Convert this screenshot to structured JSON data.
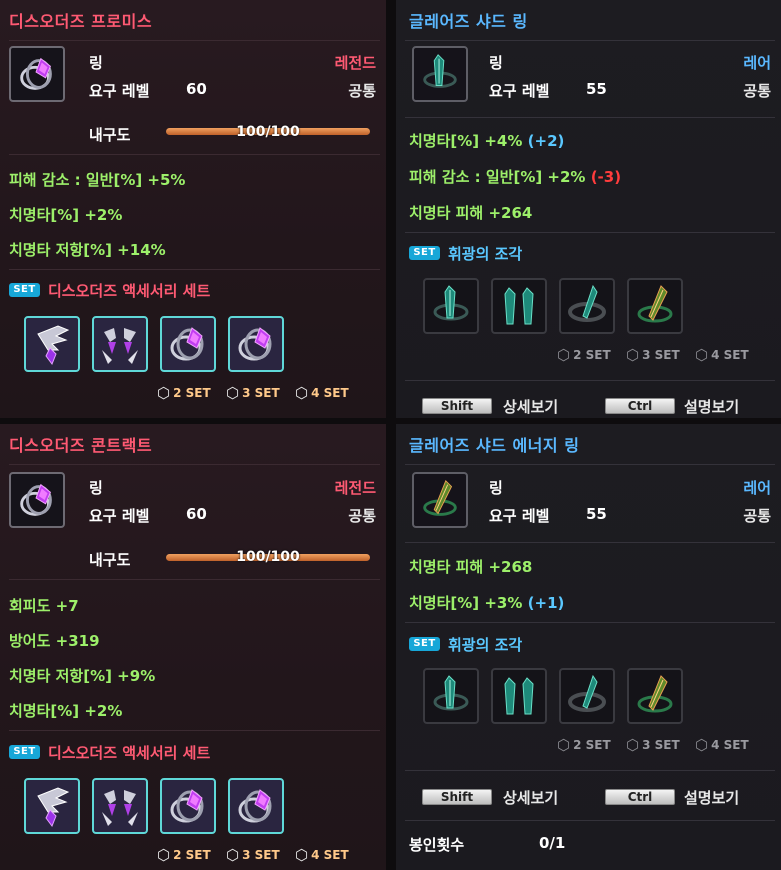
{
  "colors": {
    "legend": "#ff5a73",
    "rare": "#5ab8ff",
    "stat": "#9df06a",
    "bonus_up": "#5ac8ff",
    "bonus_down": "#ff3c3c",
    "set_badge": "#17a7d8",
    "durability_bar": "#e08a48"
  },
  "set_badge_text": "SET",
  "cube_glyph": "⬡",
  "panels": [
    {
      "title": "디스오더즈 프로미스",
      "item_type": "링",
      "grade": "레전드",
      "req_label": "요구 레벨",
      "req_level": "60",
      "class": "공통",
      "durability_label": "내구도",
      "durability_text": "100/100",
      "durability_fraction": 1.0,
      "stats": [
        "피해 감소 : 일반[%] +5%",
        "치명타[%] +2%",
        "치명타 저항[%] +14%"
      ],
      "set_name": "디스오더즈 액세서리 세트",
      "set_items": [
        "wing-purple-icon",
        "twin-pendant-icon",
        "purple-ring-icon",
        "purple-ring-icon"
      ],
      "set_counts": [
        "2 SET",
        "3 SET",
        "4 SET"
      ]
    },
    {
      "title": "글레어즈 샤드 링",
      "item_type": "링",
      "grade": "레어",
      "req_label": "요구 레벨",
      "req_level": "55",
      "class": "공통",
      "stats": [
        {
          "text": "치명타[%] +4%",
          "bonus": "(+2)"
        },
        {
          "text": "피해 감소 : 일반[%] +2%",
          "bonus": "(-3)"
        },
        {
          "text": "치명타 피해 +264",
          "bonus": ""
        }
      ],
      "set_name": "휘광의 조각",
      "set_items": [
        "teal-ring-icon",
        "teal-twin-icon",
        "teal-shard-ring-icon",
        "green-shard-ring-icon"
      ],
      "set_counts": [
        "2 SET",
        "3 SET",
        "4 SET"
      ],
      "shift_key": "Shift",
      "shift_label": "상세보기",
      "ctrl_key": "Ctrl",
      "ctrl_label": "설명보기"
    },
    {
      "title": "디스오더즈 콘트랙트",
      "item_type": "링",
      "grade": "레전드",
      "req_label": "요구 레벨",
      "req_level": "60",
      "class": "공통",
      "durability_label": "내구도",
      "durability_text": "100/100",
      "durability_fraction": 1.0,
      "stats": [
        "회피도 +7",
        "방어도 +319",
        "치명타 저항[%] +9%",
        "치명타[%] +2%"
      ],
      "set_name": "디스오더즈 액세서리 세트",
      "set_items": [
        "wing-purple-icon",
        "twin-pendant-icon",
        "purple-ring-icon",
        "purple-ring-icon"
      ],
      "set_counts": [
        "2 SET",
        "3 SET",
        "4 SET"
      ]
    },
    {
      "title": "글레어즈 샤드 에너지 링",
      "item_type": "링",
      "grade": "레어",
      "req_label": "요구 레벨",
      "req_level": "55",
      "class": "공통",
      "stats": [
        {
          "text": "치명타 피해 +268",
          "bonus": ""
        },
        {
          "text": "치명타[%] +3%",
          "bonus": "(+1)"
        }
      ],
      "set_name": "휘광의 조각",
      "set_items": [
        "teal-ring-icon",
        "teal-twin-icon",
        "teal-shard-ring-icon",
        "green-shard-ring-icon"
      ],
      "set_counts": [
        "2 SET",
        "3 SET",
        "4 SET"
      ],
      "shift_key": "Shift",
      "shift_label": "상세보기",
      "ctrl_key": "Ctrl",
      "ctrl_label": "설명보기",
      "seal_label": "봉인횟수",
      "seal_value": "0/1"
    }
  ]
}
